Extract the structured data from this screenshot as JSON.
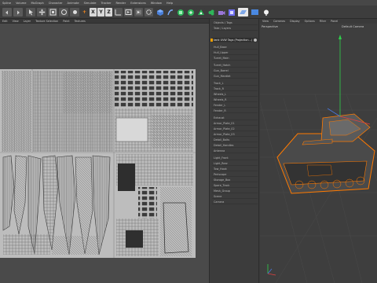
{
  "menu": {
    "items": [
      "Spline",
      "Volume",
      "MoGraph",
      "Character",
      "Animate",
      "Simulate",
      "Tracker",
      "Render",
      "Extensions",
      "Window",
      "Help"
    ]
  },
  "left_menu": {
    "items": [
      "Edit",
      "View",
      "Layer",
      "Texture Selection",
      "Paint",
      "Textures"
    ]
  },
  "object_manager": {
    "rows": [
      {
        "label": "Objects / Tags",
        "selected": false
      },
      {
        "label": "Take / Layers",
        "selected": false
      },
      {
        "label": "tank UVW Tags (Projection...)",
        "selected": true
      },
      {
        "label": "Hull_Base",
        "selected": false
      },
      {
        "label": "Hull_Upper",
        "selected": false
      },
      {
        "label": "Turret_Main",
        "selected": false
      },
      {
        "label": "Turret_Hatch",
        "selected": false
      },
      {
        "label": "Gun_Barrel",
        "selected": false
      },
      {
        "label": "Gun_Mantlet",
        "selected": false
      },
      {
        "label": "Track_L",
        "selected": false
      },
      {
        "label": "Track_R",
        "selected": false
      },
      {
        "label": "Wheels_L",
        "selected": false
      },
      {
        "label": "Wheels_R",
        "selected": false
      },
      {
        "label": "Fender_L",
        "selected": false
      },
      {
        "label": "Fender_R",
        "selected": false
      },
      {
        "label": "Exhaust",
        "selected": false
      },
      {
        "label": "Armor_Plate_01",
        "selected": false
      },
      {
        "label": "Armor_Plate_02",
        "selected": false
      },
      {
        "label": "Armor_Plate_03",
        "selected": false
      },
      {
        "label": "Detail_Bolts",
        "selected": false
      },
      {
        "label": "Detail_Handles",
        "selected": false
      },
      {
        "label": "Antenna",
        "selected": false
      },
      {
        "label": "Light_Front",
        "selected": false
      },
      {
        "label": "Light_Rear",
        "selected": false
      },
      {
        "label": "Tow_Hook",
        "selected": false
      },
      {
        "label": "Periscope",
        "selected": false
      },
      {
        "label": "Storage_Box",
        "selected": false
      },
      {
        "label": "Spare_Track",
        "selected": false
      },
      {
        "label": "Mesh_Group",
        "selected": false
      },
      {
        "label": "Scene",
        "selected": false
      },
      {
        "label": "Camera",
        "selected": false
      }
    ]
  },
  "viewport": {
    "menu": [
      "View",
      "Cameras",
      "Display",
      "Options",
      "Filter",
      "Panel"
    ],
    "label": "Perspective",
    "camera": "Default Camera"
  },
  "colors": {
    "accent": "#ff7a00",
    "selection": "#f0a000",
    "axis_y": "#2fd14b",
    "axis_x": "#e04040",
    "axis_z": "#4a78e0"
  }
}
